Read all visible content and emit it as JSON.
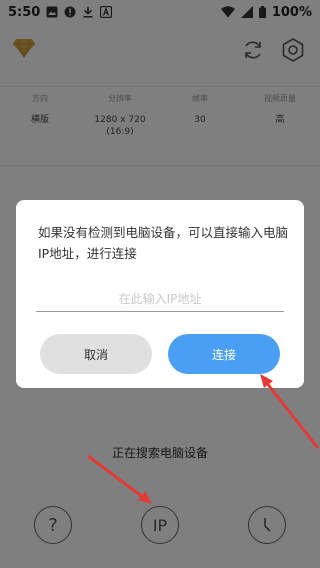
{
  "status_bar": {
    "time": "5:50",
    "battery": "100%",
    "left_icons": [
      "image-icon",
      "alert-icon",
      "download-icon",
      "a-box-icon"
    ],
    "right_icons": [
      "wifi-icon",
      "signal-icon",
      "battery-icon"
    ]
  },
  "top_bar": {
    "logo_icon": "diamond-logo-icon",
    "refresh_icon": "refresh-icon",
    "settings_icon": "hexagon-gear-icon"
  },
  "info": {
    "columns": [
      {
        "label": "方向",
        "value": "横版"
      },
      {
        "label": "分辨率",
        "value": "1280 x 720\n(16:9)"
      },
      {
        "label": "帧率",
        "value": "30"
      },
      {
        "label": "视频质量",
        "value": "高"
      }
    ]
  },
  "searching_text": "正在搜索电脑设备",
  "bottom": {
    "help_label": "?",
    "ip_label": "IP",
    "history_icon": "clock-icon"
  },
  "dialog": {
    "message": "如果没有检测到电脑设备，可以直接输入电脑IP地址，进行连接",
    "input_placeholder": "在此输入IP地址",
    "input_value": "",
    "cancel_label": "取消",
    "connect_label": "连接"
  },
  "colors": {
    "accent": "#4a9ff5",
    "cancel_bg": "#e0e0e0",
    "annotation_arrow": "#e53935",
    "logo": "#d4a64a"
  }
}
